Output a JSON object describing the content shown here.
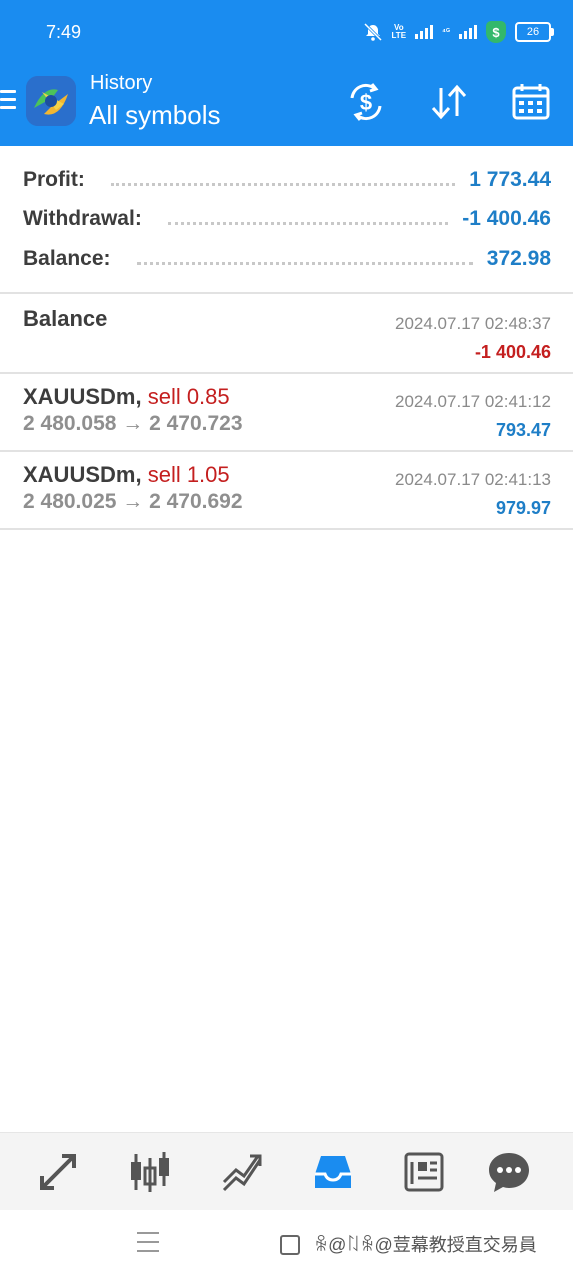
{
  "status_bar": {
    "time": "7:49",
    "network_label": "Vo\nLTE",
    "network_4g": "4G",
    "shield_symbol": "$",
    "battery": "26"
  },
  "app_bar": {
    "title": "History",
    "subtitle": "All symbols",
    "icons": [
      "menu-icon",
      "metatrader-logo",
      "dollar-switch-icon",
      "sort-icon",
      "calendar-icon"
    ]
  },
  "summary": {
    "profit_label": "Profit:",
    "profit_value": "1 773.44",
    "withdrawal_label": "Withdrawal:",
    "withdrawal_value": "-1 400.46",
    "balance_label": "Balance:",
    "balance_value": "372.98"
  },
  "deals": [
    {
      "symbol": "Balance",
      "type": "",
      "prices": "",
      "time": "2024.07.17 02:48:37",
      "profit": "-1 400.46"
    },
    {
      "symbol": "XAUUSDm,",
      "type": "sell 0.85",
      "prices": "2 480.058 → 2 470.723",
      "time": "2024.07.17 02:41:12",
      "profit": "793.47"
    },
    {
      "symbol": "XAUUSDm,",
      "type": "sell 1.05",
      "prices": "2 480.025 → 2 470.692",
      "time": "2024.07.17 02:41:13",
      "profit": "979.97"
    }
  ],
  "bottom_nav": {
    "items": [
      "quotes-icon",
      "chart-icon",
      "trade-icon",
      "history-icon",
      "news-icon",
      "chat-icon"
    ],
    "active": "history-icon"
  },
  "watermark": "ꆜ@ꇁꆜ@荳幕教授直交易員",
  "colors": {
    "accent": "#1a8cf0",
    "positive": "#1e7ec7",
    "negative": "#c41f1f"
  }
}
